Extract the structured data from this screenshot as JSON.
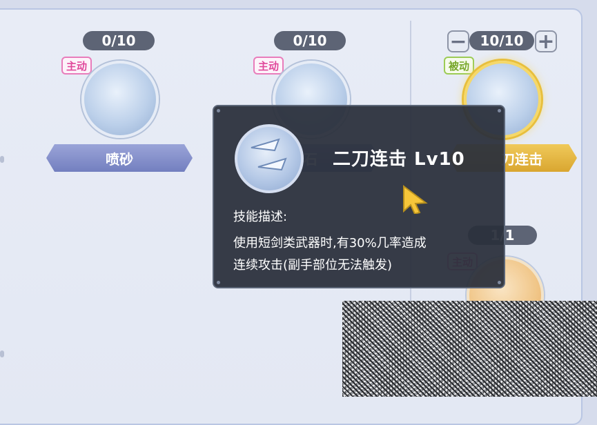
{
  "skills": [
    {
      "level": "0/10",
      "type": "主动",
      "name": "喷砂"
    },
    {
      "level": "0/10",
      "type": "主动",
      "name": "石"
    },
    {
      "level": "10/10",
      "type": "被动",
      "name": "刀连击"
    },
    {
      "level": "1/1",
      "type": "主动"
    }
  ],
  "stepper": {
    "minus": "−",
    "plus": "+"
  },
  "tooltip": {
    "title": "二刀连击 Lv10",
    "heading": "技能描述:",
    "lines": [
      "使用短剑类武器时,有30%几率造成",
      "连续攻击(副手部位无法触发)"
    ]
  },
  "colors": {
    "active_tag": "#e0489b",
    "passive_tag": "#77a72a",
    "tooltip_bg": "#2a303c",
    "banner_gold": "#d9a630"
  }
}
